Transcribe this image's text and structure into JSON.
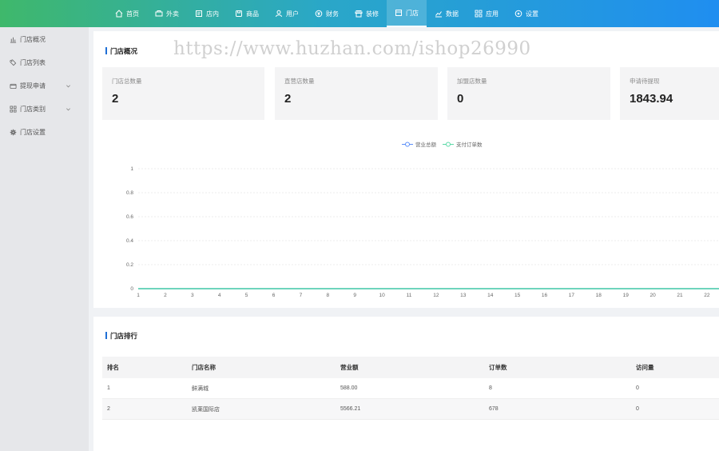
{
  "nav": {
    "items": [
      {
        "label": "首页",
        "icon": "home-icon"
      },
      {
        "label": "外卖",
        "icon": "takeout-icon"
      },
      {
        "label": "店内",
        "icon": "store-icon"
      },
      {
        "label": "商品",
        "icon": "goods-icon"
      },
      {
        "label": "用户",
        "icon": "user-icon"
      },
      {
        "label": "财务",
        "icon": "finance-icon"
      },
      {
        "label": "装修",
        "icon": "decorate-icon"
      },
      {
        "label": "门店",
        "icon": "shop-icon"
      },
      {
        "label": "数据",
        "icon": "data-icon"
      },
      {
        "label": "应用",
        "icon": "apps-icon"
      },
      {
        "label": "设置",
        "icon": "settings-icon"
      }
    ],
    "active_index": 7
  },
  "sidebar": {
    "items": [
      {
        "label": "门店概况",
        "icon": "bar-chart-icon"
      },
      {
        "label": "门店列表",
        "icon": "list-icon"
      },
      {
        "label": "提现申请",
        "icon": "wallet-icon",
        "expandable": true
      },
      {
        "label": "门店类别",
        "icon": "grid-icon",
        "expandable": true
      },
      {
        "label": "门店设置",
        "icon": "gear-icon"
      }
    ]
  },
  "overview": {
    "title": "门店概况",
    "watermark": "https://www.huzhan.com/ishop26990",
    "stats": [
      {
        "label": "门店总数量",
        "value": "2"
      },
      {
        "label": "直营店数量",
        "value": "2"
      },
      {
        "label": "加盟店数量",
        "value": "0"
      },
      {
        "label": "申请待提现",
        "value": "1843.94"
      }
    ]
  },
  "chart_data": {
    "type": "line",
    "x": [
      "1",
      "2",
      "3",
      "4",
      "5",
      "6",
      "7",
      "8",
      "9",
      "10",
      "11",
      "12",
      "13",
      "14",
      "15",
      "16",
      "17",
      "18",
      "19",
      "20",
      "21",
      "22"
    ],
    "series": [
      {
        "name": "营业总额",
        "values": [
          0,
          0,
          0,
          0,
          0,
          0,
          0,
          0,
          0,
          0,
          0,
          0,
          0,
          0,
          0,
          0,
          0,
          0,
          0,
          0,
          0,
          0
        ],
        "color": "#5b8ff9"
      },
      {
        "name": "支付订单数",
        "values": [
          0,
          0,
          0,
          0,
          0,
          0,
          0,
          0,
          0,
          0,
          0,
          0,
          0,
          0,
          0,
          0,
          0,
          0,
          0,
          0,
          0,
          0
        ],
        "color": "#5ad8a6"
      }
    ],
    "yticks": [
      "0",
      "0.2",
      "0.4",
      "0.6",
      "0.8",
      "1"
    ],
    "ylim": [
      0,
      1
    ],
    "grid": true,
    "legend": "top-center"
  },
  "ranking": {
    "title": "门店排行",
    "columns": [
      "排名",
      "门店名称",
      "营业额",
      "订单数",
      "访问量"
    ],
    "rows": [
      [
        "1",
        "鲜满城",
        "588.00",
        "8",
        "0"
      ],
      [
        "2",
        "凯莱国际店",
        "5566.21",
        "678",
        "0"
      ]
    ]
  },
  "colors": {
    "accent": "#1f6fd6",
    "topbar_start": "#3fb86b",
    "topbar_end": "#1f8ef0"
  }
}
